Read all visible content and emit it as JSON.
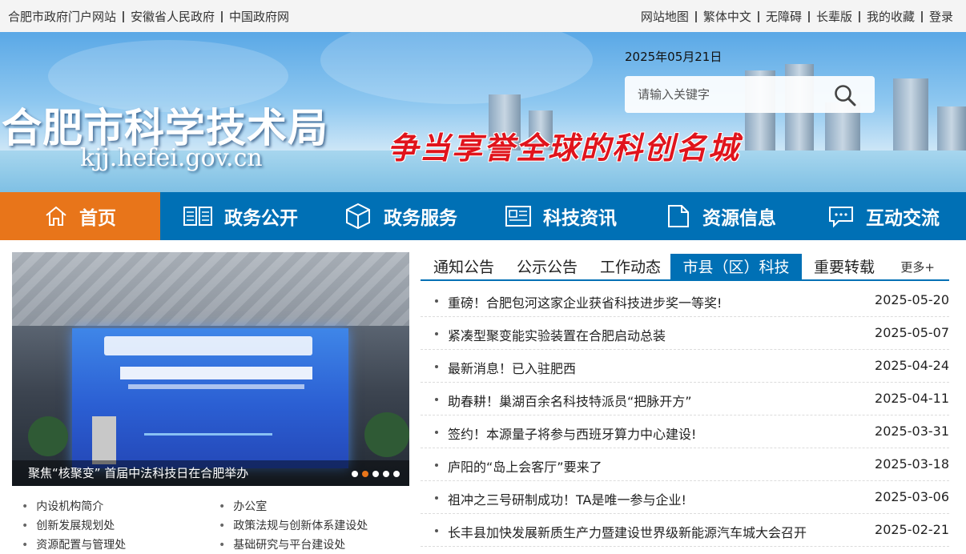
{
  "topbar": {
    "left_links": [
      "合肥市政府门户网站",
      "安徽省人民政府",
      "中国政府网"
    ],
    "right_links": [
      "网站地图",
      "繁体中文",
      "无障碍",
      "长辈版",
      "我的收藏",
      "登录"
    ]
  },
  "banner": {
    "site_title": "合肥市科学技术局",
    "site_domain": "kjj.hefei.gov.cn",
    "slogan": "争当享誉全球的科创名城",
    "date": "2025年05月21日",
    "search_placeholder": "请输入关键字",
    "search_icon": "search-icon"
  },
  "nav": {
    "items": [
      {
        "label": "首页",
        "icon": "home-icon"
      },
      {
        "label": "政务公开",
        "icon": "book-icon"
      },
      {
        "label": "政务服务",
        "icon": "cube-icon"
      },
      {
        "label": "科技资讯",
        "icon": "newspaper-icon"
      },
      {
        "label": "资源信息",
        "icon": "folder-icon"
      },
      {
        "label": "互动交流",
        "icon": "chat-icon"
      }
    ],
    "active_color": "#e8751a",
    "bar_color": "#0070b5"
  },
  "slider": {
    "caption": "聚焦“核聚变” 首届中法科技日在合肥举办",
    "dot_count": 5,
    "active_dot": 2
  },
  "org_links": [
    "内设机构简介",
    "办公室",
    "创新发展规划处",
    "政策法规与创新体系建设处",
    "资源配置与管理处",
    "基础研究与平台建设处"
  ],
  "news": {
    "tabs": [
      "通知公告",
      "公示公告",
      "工作动态",
      "市县（区）科技",
      "重要转载"
    ],
    "active_tab": 3,
    "more_label": "更多+",
    "items": [
      {
        "title": "重磅！合肥包河这家企业获省科技进步奖一等奖!",
        "date": "2025-05-20"
      },
      {
        "title": "紧凑型聚变能实验装置在合肥启动总装",
        "date": "2025-05-07"
      },
      {
        "title": "最新消息！已入驻肥西",
        "date": "2025-04-24"
      },
      {
        "title": "助春耕！巢湖百余名科技特派员“把脉开方”",
        "date": "2025-04-11"
      },
      {
        "title": "签约！本源量子将参与西班牙算力中心建设!",
        "date": "2025-03-31"
      },
      {
        "title": "庐阳的“岛上会客厅”要来了",
        "date": "2025-03-18"
      },
      {
        "title": "祖冲之三号研制成功！TA是唯一参与企业!",
        "date": "2025-03-06"
      },
      {
        "title": "长丰县加快发展新质生产力暨建设世界级新能源汽车城大会召开",
        "date": "2025-02-21"
      }
    ]
  }
}
